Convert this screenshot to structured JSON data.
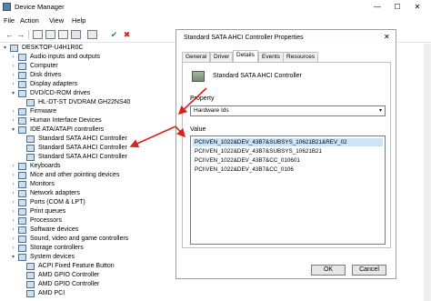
{
  "window": {
    "title": "Device Manager",
    "min": "—",
    "max": "☐",
    "close": "✕"
  },
  "menu": [
    "File",
    "Action",
    "View",
    "Help"
  ],
  "toolbar": {
    "back": "←",
    "forward": "→",
    "enable": "✔",
    "remove": "✖"
  },
  "tree": [
    {
      "label": "DESKTOP-U4H1R0C",
      "depth": 0,
      "exp": "▾"
    },
    {
      "label": "Audio inputs and outputs",
      "depth": 1,
      "exp": "›"
    },
    {
      "label": "Computer",
      "depth": 1,
      "exp": "›"
    },
    {
      "label": "Disk drives",
      "depth": 1,
      "exp": "›"
    },
    {
      "label": "Display adapters",
      "depth": 1,
      "exp": "›"
    },
    {
      "label": "DVD/CD-ROM drives",
      "depth": 1,
      "exp": "▾"
    },
    {
      "label": "HL-DT-ST DVDRAM GH22NS40",
      "depth": 2,
      "exp": ""
    },
    {
      "label": "Firmware",
      "depth": 1,
      "exp": "›"
    },
    {
      "label": "Human Interface Devices",
      "depth": 1,
      "exp": "›"
    },
    {
      "label": "IDE ATA/ATAPI controllers",
      "depth": 1,
      "exp": "▾"
    },
    {
      "label": "Standard SATA AHCI Controller",
      "depth": 2,
      "exp": ""
    },
    {
      "label": "Standard SATA AHCI Controller",
      "depth": 2,
      "exp": ""
    },
    {
      "label": "Standard SATA AHCI Controller",
      "depth": 2,
      "exp": ""
    },
    {
      "label": "Keyboards",
      "depth": 1,
      "exp": "›"
    },
    {
      "label": "Mice and other pointing devices",
      "depth": 1,
      "exp": "›"
    },
    {
      "label": "Monitors",
      "depth": 1,
      "exp": "›"
    },
    {
      "label": "Network adapters",
      "depth": 1,
      "exp": "›"
    },
    {
      "label": "Ports (COM & LPT)",
      "depth": 1,
      "exp": "›"
    },
    {
      "label": "Print queues",
      "depth": 1,
      "exp": "›"
    },
    {
      "label": "Processors",
      "depth": 1,
      "exp": "›"
    },
    {
      "label": "Software devices",
      "depth": 1,
      "exp": "›"
    },
    {
      "label": "Sound, video and game controllers",
      "depth": 1,
      "exp": "›"
    },
    {
      "label": "Storage controllers",
      "depth": 1,
      "exp": "›"
    },
    {
      "label": "System devices",
      "depth": 1,
      "exp": "▾"
    },
    {
      "label": "ACPI Fixed Feature Button",
      "depth": 2,
      "exp": ""
    },
    {
      "label": "AMD GPIO Controller",
      "depth": 2,
      "exp": ""
    },
    {
      "label": "AMD GPIO Controller",
      "depth": 2,
      "exp": ""
    },
    {
      "label": "AMD PCI",
      "depth": 2,
      "exp": ""
    }
  ],
  "dialog": {
    "title": "Standard SATA AHCI Controller Properties",
    "close": "✕",
    "tabs": [
      "General",
      "Driver",
      "Details",
      "Events",
      "Resources"
    ],
    "active_tab": "Details",
    "device_name": "Standard SATA AHCI Controller",
    "property_label": "Property",
    "property_value": "Hardware Ids",
    "property_arrow": "▾",
    "value_label": "Value",
    "values": [
      "PCI\\VEN_1022&DEV_43B7&SUBSYS_10621B21&REV_02",
      "PCI\\VEN_1022&DEV_43B7&SUBSYS_10621B21",
      "PCI\\VEN_1022&DEV_43B7&CC_010601",
      "PCI\\VEN_1022&DEV_43B7&CC_0106"
    ],
    "ok_label": "OK",
    "cancel_label": "Cancel"
  },
  "colors": {
    "arrow": "#e0201a",
    "selection": "#cce4f7"
  }
}
